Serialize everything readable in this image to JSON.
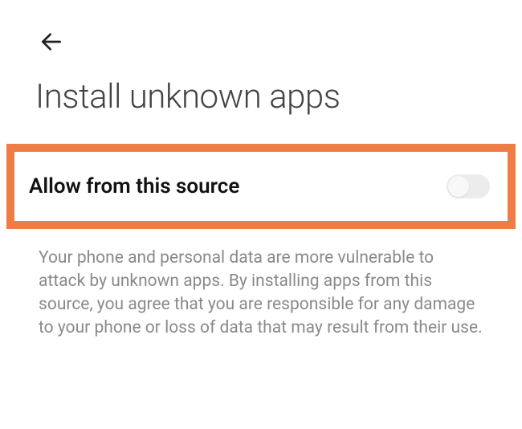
{
  "header": {
    "title": "Install unknown apps"
  },
  "setting": {
    "label": "Allow from this source",
    "enabled": false
  },
  "description": "Your phone and personal data are more vulnerable to attack by unknown apps. By installing apps from this source, you agree that you are responsible for any damage to your phone or loss of data that may result from their use.",
  "colors": {
    "highlight_border": "#ee7c45"
  }
}
